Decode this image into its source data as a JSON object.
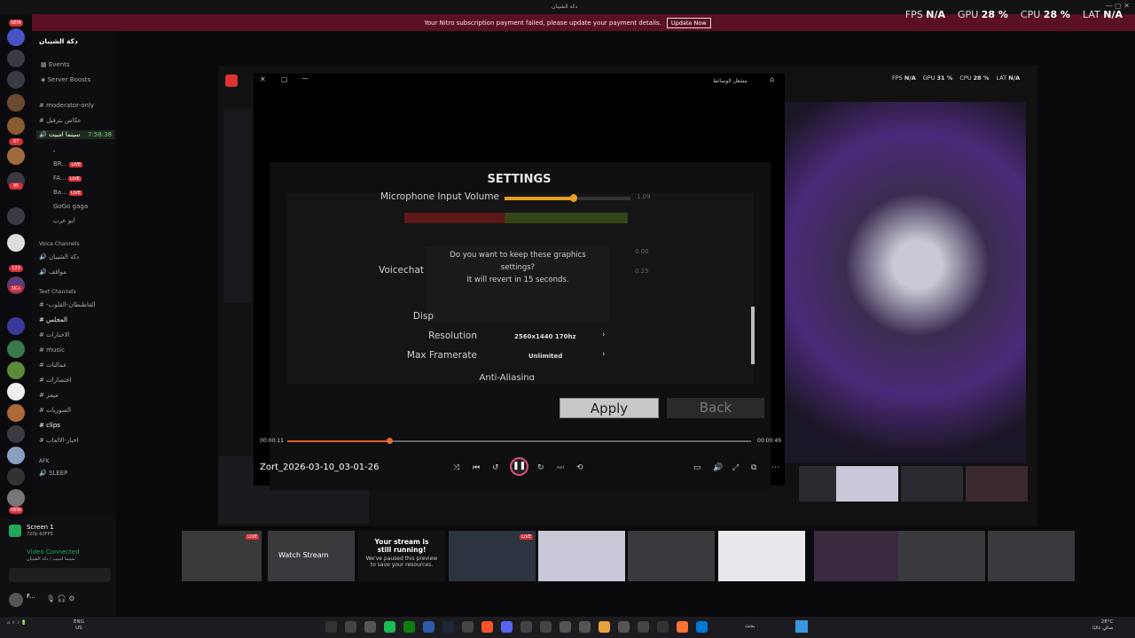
{
  "titlebar": {
    "title": "دكة الشيبان"
  },
  "nitro": {
    "message": "Your Nitro subscription payment failed, please update your payment details.",
    "button": "Update Now"
  },
  "perf": {
    "fps_label": "FPS",
    "fps": "N/A",
    "gpu_label": "GPU",
    "gpu": "28 %",
    "cpu_label": "CPU",
    "cpu": "28 %",
    "lat_label": "LAT",
    "lat": "N/A"
  },
  "servers": {
    "new1": "NEW",
    "badges": [
      "67",
      "95",
      "123",
      "1K+"
    ],
    "new2": "NEW"
  },
  "sidebar": {
    "server_name": "دكة الشيبان",
    "events": "Events",
    "boosts": "Server Boosts",
    "moderator": "moderator-only",
    "rules": "عكاس بترفيل",
    "active_channel": "سينما امبيت",
    "active_time": "7:58:38",
    "users": [
      {
        "name": "ـ",
        "live": ""
      },
      {
        "name": "BR...",
        "live": "LIVE"
      },
      {
        "name": "FA...",
        "live": "LIVE"
      },
      {
        "name": "Ba...",
        "live": "LIVE"
      },
      {
        "name": "GoGo gaga",
        "live": ""
      },
      {
        "name": "ابو عرب",
        "live": ""
      }
    ],
    "voice_header": "Voice Channels",
    "voice": [
      "دكة الشيبان",
      "مواقف"
    ],
    "text_header": "Text Channels",
    "text": [
      "-القاطنطان-القلوب",
      "المجلس",
      "الاخبارات",
      "music",
      "عمالنات",
      "اختصارات",
      "ميمز",
      "الصوريات",
      "clips",
      "اخبار-الالعاب"
    ],
    "afk_header": "AFK",
    "afk": "SLEEP"
  },
  "userpanel": {
    "screen": "Screen 1",
    "screen_sub": "720p 60FPS",
    "video": "Video Connected",
    "video_sub": "سينما امبيت / دكة الشيبان",
    "user": "F...",
    "user_sub": "..."
  },
  "bg_overlay": {
    "fps_label": "FPS",
    "fps": "N/A",
    "gpu_label": "GPU",
    "gpu": "31 %",
    "cpu_label": "CPU",
    "cpu": "28 %",
    "lat_label": "LAT",
    "lat": "N/A"
  },
  "player": {
    "app_title": "مشغل الوسائط",
    "settings_title": "SETTINGS",
    "mic_label": "Microphone Input Volume",
    "mic_value": "1.09",
    "voicechat_label": "Voicechat",
    "val1": "0.00",
    "val2": "0.25",
    "display_label": "Disp",
    "resolution_label": "Resolution",
    "resolution_value": "2560x1440 170hz",
    "framerate_label": "Max Framerate",
    "framerate_value": "Unlimited",
    "aa_label": "Anti-Aliasing",
    "dialog_text1": "Do you want to keep these graphics settings?",
    "dialog_text2": "It will revert in 15 seconds.",
    "apply": "Apply",
    "back": "Back",
    "time_current": "00:00:11",
    "time_total": "00:00:49",
    "progress": 0.22,
    "filename": "Zort_2026-03-10_03-01-26"
  },
  "thumbs": {
    "watch": "Watch Stream",
    "paused_title": "Your stream is still running!",
    "paused_sub": "We've paused this preview to save your resources.",
    "live": "LIVE"
  },
  "taskbar": {
    "lang": "ENG",
    "region": "US",
    "temp": "28°C",
    "weather": "صافٍ غالبًا",
    "search": "بحث"
  }
}
